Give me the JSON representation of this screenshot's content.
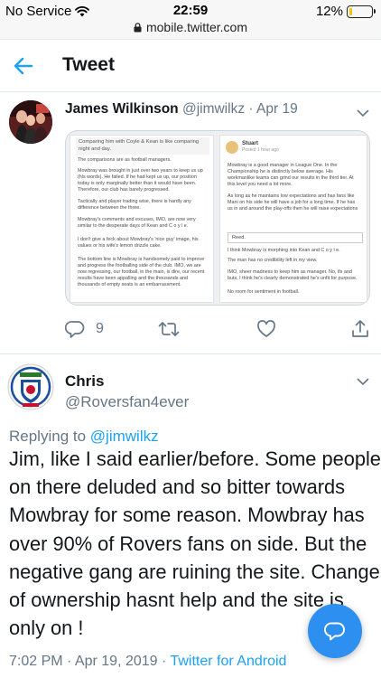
{
  "status_bar": {
    "carrier": "No Service",
    "time": "22:59",
    "battery": "12%",
    "battery_level": 0.12,
    "url": "mobile.twitter.com"
  },
  "header": {
    "title": "Tweet"
  },
  "original_tweet": {
    "name": "James Wilkinson",
    "handle": "@jimwilkz",
    "separator": "·",
    "date": "Apr 19",
    "embed": {
      "left": {
        "quote": "Comparing him with Coyle & Kean is like comparing night and day.",
        "paragraphs": [
          "The comparisons are as football managers.",
          "Mowbray was brought in just over two years to keep us up (his words). He failed. If he had kept us up, our position today is only marginally better than it would have been. Therefore, our club has barely progressed.",
          "Tactically and player trading wise, there is hardly any difference between the three.",
          "Mowbray's comments and excuses, IMO, are now very similar to the desperate days of Kean and C o y l e.",
          "I don't give a feck about Mowbray's 'nice guy' image, his values or his wife's lemon drizzle cake.",
          "The bottom line is Mowbray is handsomely paid to improve and progress the footballing side of the club. IMO, we are now regressing, our football, in the main, is dire, our recent results have been appalling and the thousands and thousands of empty seats is an embarrassment."
        ]
      },
      "right": {
        "author": "Stuart",
        "posted": "Posted 1 hour ago",
        "paragraphs_top": [
          "Mowbray is a good manager in League One. In the Championship he is distinctly below average. His workmanlike teams can grind our results in the third tier. At this level you need a lot more.",
          "As long as he maintains low expectations and has fans like Mani on his side he will have a job for a long time. If he has us in and around the play-offs then he will raise expectations"
        ],
        "reed": "Reed.",
        "paragraphs_bottom": [
          "I think Mowbray is morphing into Kean and C o y l e.",
          "The man has no credibility left in my view.",
          "IMO, sheer madness to keep him as manager. No, ifs and buts, I think he's clearly demonstrated he's unfit for purpose.",
          "No room for sentiment in football."
        ]
      }
    },
    "reply_count": "9"
  },
  "reply_tweet": {
    "name": "Chris",
    "handle": "@Roversfan4ever",
    "replying_prefix": "Replying to",
    "replying_to": "@jimwilkz",
    "text": "Jim, like I said earlier/before. Some people on there deluded and so bitter towards Mowbray for some reason. Mowbray has over 90% of Rovers fans on side. But the negative gang are ruining the site. Change of ownership hasnt help and the site is only on                !",
    "timestamp": "7:02 PM · Apr 19, 2019 ·",
    "client": "Twitter for Android"
  },
  "colors": {
    "accent": "#1da1f2",
    "fab": "#2d8ff0",
    "secondary_text": "#657786"
  },
  "icons": [
    "wifi-icon",
    "lock-icon",
    "back-arrow-icon",
    "chevron-down-icon",
    "reply-icon",
    "retweet-icon",
    "like-icon",
    "share-icon",
    "compose-reply-icon"
  ]
}
